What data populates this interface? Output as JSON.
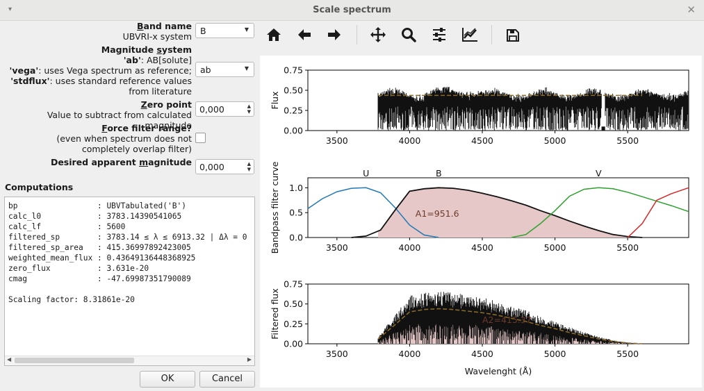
{
  "window": {
    "title": "Scale spectrum",
    "menu_glyph": "▾",
    "close_glyph": "✕"
  },
  "form": {
    "band": {
      "label_b": "B",
      "label_rest": "and name",
      "sublabel": "UBVRI-x system",
      "value": "B"
    },
    "magsys": {
      "label_pre": "Magnitude ",
      "label_s": "s",
      "label_rest": "ystem",
      "ab_key": "'ab'",
      "ab_desc": ": AB[solute]",
      "vega_key": "'vega'",
      "vega_desc": ": uses Vega spectrum as reference;",
      "std_key": "'stdflux'",
      "std_desc": ": uses standard reference values",
      "std_desc2": "from literature",
      "value": "ab"
    },
    "zero": {
      "label_z": "Z",
      "label_rest": "ero point",
      "sublabel": "Value to subtract from calculated magnitude",
      "value": "0,000"
    },
    "force": {
      "label_f": "F",
      "label_rest": "orce filter range?",
      "sub1": "(even when spectrum does not",
      "sub2": "completely overlap filter)"
    },
    "desired": {
      "label_pre": "Desired apparent ",
      "label_m": "m",
      "label_rest": "agnitude",
      "value": "0,000"
    }
  },
  "computations": {
    "header": "Computations",
    "lines": [
      "bp                 : UBVTabulated('B')",
      "calc_l0            : 3783.14390541065",
      "calc_lf            : 5600",
      "filtered_sp        : 3783.14 ≤ λ ≤ 6913.32 | Δλ = 0",
      "filtered_sp_area   : 415.36997892423005",
      "weighted_mean_flux : 0.43649136448368925",
      "zero_flux          : 3.631e-20",
      "cmag               : -47.69987351790089",
      "",
      "Scaling factor: 8.31861e-20"
    ]
  },
  "buttons": {
    "ok": "OK",
    "cancel": "Cancel"
  },
  "toolbar": [
    {
      "name": "home-icon"
    },
    {
      "name": "back-arrow-icon"
    },
    {
      "name": "forward-arrow-icon"
    },
    {
      "name": "pan-icon"
    },
    {
      "name": "zoom-icon"
    },
    {
      "name": "subplots-config-icon"
    },
    {
      "name": "axes-edit-icon"
    },
    {
      "name": "save-icon"
    }
  ],
  "plots": {
    "xticks": [
      "3500",
      "4000",
      "4500",
      "5000",
      "5500"
    ],
    "flux": {
      "ylabel": "Flux",
      "yticks": [
        "0.00",
        "0.25",
        "0.50",
        "0.75"
      ]
    },
    "bandpass": {
      "ylabel": "Bandpass filter curve",
      "yticks": [
        "0.0",
        "0.5",
        "1.0"
      ],
      "labels": {
        "u": "U",
        "b": "B",
        "v": "V"
      },
      "area_label": "A1=951.6"
    },
    "filtered": {
      "ylabel": "Filtered flux",
      "yticks": [
        "0.00",
        "0.25",
        "0.50",
        "0.75"
      ],
      "area_label": "A2=415.37"
    },
    "xlabel": "Wavelenght (Å)"
  },
  "chart_data": [
    {
      "type": "line",
      "ylabel": "Flux",
      "xlim": [
        3300,
        5920
      ],
      "ylim": [
        0,
        0.75
      ],
      "series": [
        {
          "x": [
            3783,
            5920
          ],
          "y_range": [
            0.0,
            0.55
          ]
        },
        {
          "x": [
            3783,
            5600
          ],
          "y": [
            0.436,
            0.436
          ]
        }
      ]
    },
    {
      "type": "line",
      "ylabel": "Bandpass filter curve",
      "xlim": [
        3300,
        5920
      ],
      "ylim": [
        0,
        1.2
      ],
      "annotations": [
        "U",
        "B",
        "V",
        "A1=951.6"
      ],
      "series": [
        {
          "name": "U",
          "x": [
            3300,
            3400,
            3500,
            3600,
            3700,
            3800,
            3900,
            4000,
            4100,
            4200
          ],
          "y": [
            0.58,
            0.78,
            0.92,
            0.99,
            1.0,
            0.9,
            0.6,
            0.25,
            0.05,
            0.0
          ]
        },
        {
          "name": "B",
          "x": [
            3600,
            3700,
            3800,
            3900,
            4000,
            4100,
            4200,
            4300,
            4400,
            4500,
            4600,
            4700,
            4800,
            4900,
            5000,
            5100,
            5200,
            5300,
            5400,
            5500,
            5600
          ],
          "y": [
            0.0,
            0.03,
            0.15,
            0.55,
            0.93,
            0.98,
            1.0,
            0.99,
            0.95,
            0.89,
            0.82,
            0.74,
            0.65,
            0.54,
            0.44,
            0.33,
            0.23,
            0.14,
            0.06,
            0.02,
            0.0
          ]
        },
        {
          "name": "V",
          "x": [
            4700,
            4800,
            4900,
            5000,
            5100,
            5200,
            5300,
            5400,
            5500,
            5600,
            5700,
            5800,
            5920
          ],
          "y": [
            0.0,
            0.06,
            0.28,
            0.54,
            0.83,
            0.97,
            1.0,
            0.98,
            0.91,
            0.82,
            0.73,
            0.64,
            0.52
          ]
        },
        {
          "name": "R",
          "x": [
            5500,
            5600,
            5700,
            5800,
            5920
          ],
          "y": [
            0.0,
            0.28,
            0.75,
            0.88,
            1.0
          ]
        }
      ]
    },
    {
      "type": "area",
      "ylabel": "Filtered flux",
      "xlabel": "Wavelenght (Å)",
      "xlim": [
        3300,
        5920
      ],
      "ylim": [
        0,
        0.75
      ],
      "annotations": [
        "A2=415.37"
      ],
      "series": [
        {
          "x": [
            3783,
            3900,
            4000,
            4100,
            4200,
            4300,
            4400,
            4500,
            4600,
            4700,
            4800,
            4900,
            5000,
            5100,
            5200,
            5300,
            5400,
            5500,
            5600
          ],
          "y": [
            0.06,
            0.24,
            0.4,
            0.43,
            0.44,
            0.43,
            0.41,
            0.39,
            0.36,
            0.32,
            0.28,
            0.23,
            0.19,
            0.14,
            0.1,
            0.06,
            0.03,
            0.01,
            0.0
          ]
        }
      ]
    }
  ]
}
